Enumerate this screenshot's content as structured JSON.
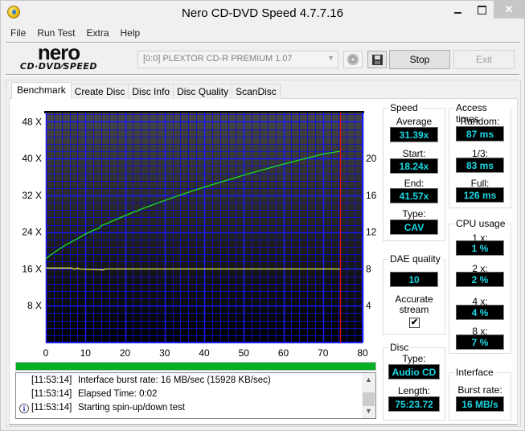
{
  "window": {
    "title": "Nero CD-DVD Speed 4.7.7.16",
    "controls": {
      "minimize": "minimize",
      "maximize": "maximize",
      "close": "✕"
    }
  },
  "menu": [
    "File",
    "Run Test",
    "Extra",
    "Help"
  ],
  "logo": {
    "brand": "nero",
    "product": "CD·DVD⁄SPEED"
  },
  "toolbar": {
    "drive": "[0:0]  PLEXTOR CD-R  PREMIUM 1.07",
    "stop_label": "Stop",
    "exit_label": "Exit"
  },
  "tabs": [
    {
      "label": "Benchmark",
      "active": true
    },
    {
      "label": "Create Disc",
      "active": false
    },
    {
      "label": "Disc Info",
      "active": false
    },
    {
      "label": "Disc Quality",
      "active": false
    },
    {
      "label": "ScanDisc",
      "active": false
    }
  ],
  "chart_data": {
    "type": "line",
    "title": "",
    "xlabel": "",
    "ylabel": "",
    "x_range": [
      0,
      80
    ],
    "x_ticks": [
      0,
      10,
      20,
      30,
      40,
      50,
      60,
      70,
      80
    ],
    "y_left_range": [
      0,
      50
    ],
    "y_left_ticks": [
      "8 X",
      "16 X",
      "24 X",
      "32 X",
      "40 X",
      "48 X"
    ],
    "y_left_tick_values": [
      8,
      16,
      24,
      32,
      40,
      48
    ],
    "y_right_range": [
      0,
      25
    ],
    "y_right_ticks": [
      4,
      8,
      12,
      16,
      20
    ],
    "grid": true,
    "disc_end_marker": 74.4,
    "series": [
      {
        "name": "Read speed",
        "color": "#1ee01e",
        "axis": "left",
        "x": [
          0,
          1,
          3,
          5,
          8,
          10,
          12,
          13.5,
          14,
          16,
          20,
          25,
          30,
          35,
          40,
          45,
          50,
          55,
          60,
          65,
          70,
          74.4
        ],
        "y": [
          18.2,
          18.9,
          20.1,
          21.2,
          22.6,
          23.6,
          24.4,
          24.9,
          25.4,
          26.1,
          27.6,
          29.3,
          30.9,
          32.4,
          33.8,
          35.1,
          36.4,
          37.6,
          38.8,
          39.9,
          41.0,
          41.6
        ]
      },
      {
        "name": "Spin",
        "color": "#f0f020",
        "axis": "right",
        "x": [
          0,
          6.5,
          7,
          7.5,
          8,
          8.5,
          14.5,
          15,
          30,
          50,
          60,
          70,
          74.4
        ],
        "y": [
          8.1,
          8.1,
          8.0,
          8.0,
          8.1,
          8.0,
          7.9,
          8.0,
          8.0,
          8.0,
          8.0,
          8.0,
          8.0
        ]
      }
    ]
  },
  "progress": {
    "percent": 100,
    "color": "#06b025"
  },
  "log": [
    {
      "icon": "",
      "time": "[11:53:14]",
      "message": "Interface burst rate: 16 MB/sec (15928 KB/sec)"
    },
    {
      "icon": "",
      "time": "[11:53:14]",
      "message": "Elapsed Time:  0:02"
    },
    {
      "icon": "info",
      "time": "[11:53:14]",
      "message": "Starting spin-up/down test"
    }
  ],
  "speed": {
    "title": "Speed",
    "average_label": "Average",
    "average": "31.39x",
    "start_label": "Start:",
    "start": "18.24x",
    "end_label": "End:",
    "end": "41.57x",
    "type_label": "Type:",
    "type": "CAV"
  },
  "access_times": {
    "title": "Access times",
    "random_label": "Random:",
    "random": "87 ms",
    "third_label": "1/3:",
    "third": "83 ms",
    "full_label": "Full:",
    "full": "126 ms"
  },
  "cpu_usage": {
    "title": "CPU usage",
    "items": [
      {
        "label": "1 x:",
        "value": "1 %"
      },
      {
        "label": "2 x:",
        "value": "2 %"
      },
      {
        "label": "4 x:",
        "value": "4 %"
      },
      {
        "label": "8 x:",
        "value": "7 %"
      }
    ]
  },
  "dae": {
    "title": "DAE quality",
    "value": "10",
    "accurate_label_1": "Accurate",
    "accurate_label_2": "stream",
    "accurate_checked": true,
    "check_glyph": "✔"
  },
  "disc": {
    "title": "Disc",
    "type_label": "Type:",
    "type": "Audio CD",
    "length_label": "Length:",
    "length": "75:23.72"
  },
  "interface": {
    "title": "Interface",
    "burst_label": "Burst rate:",
    "burst": "16 MB/s"
  },
  "colors": {
    "readout_text": "#17d8e3",
    "grid": "#1010d0",
    "speed_curve": "#1ee01e",
    "spin_curve": "#f0f020",
    "end_marker": "#e01010"
  }
}
